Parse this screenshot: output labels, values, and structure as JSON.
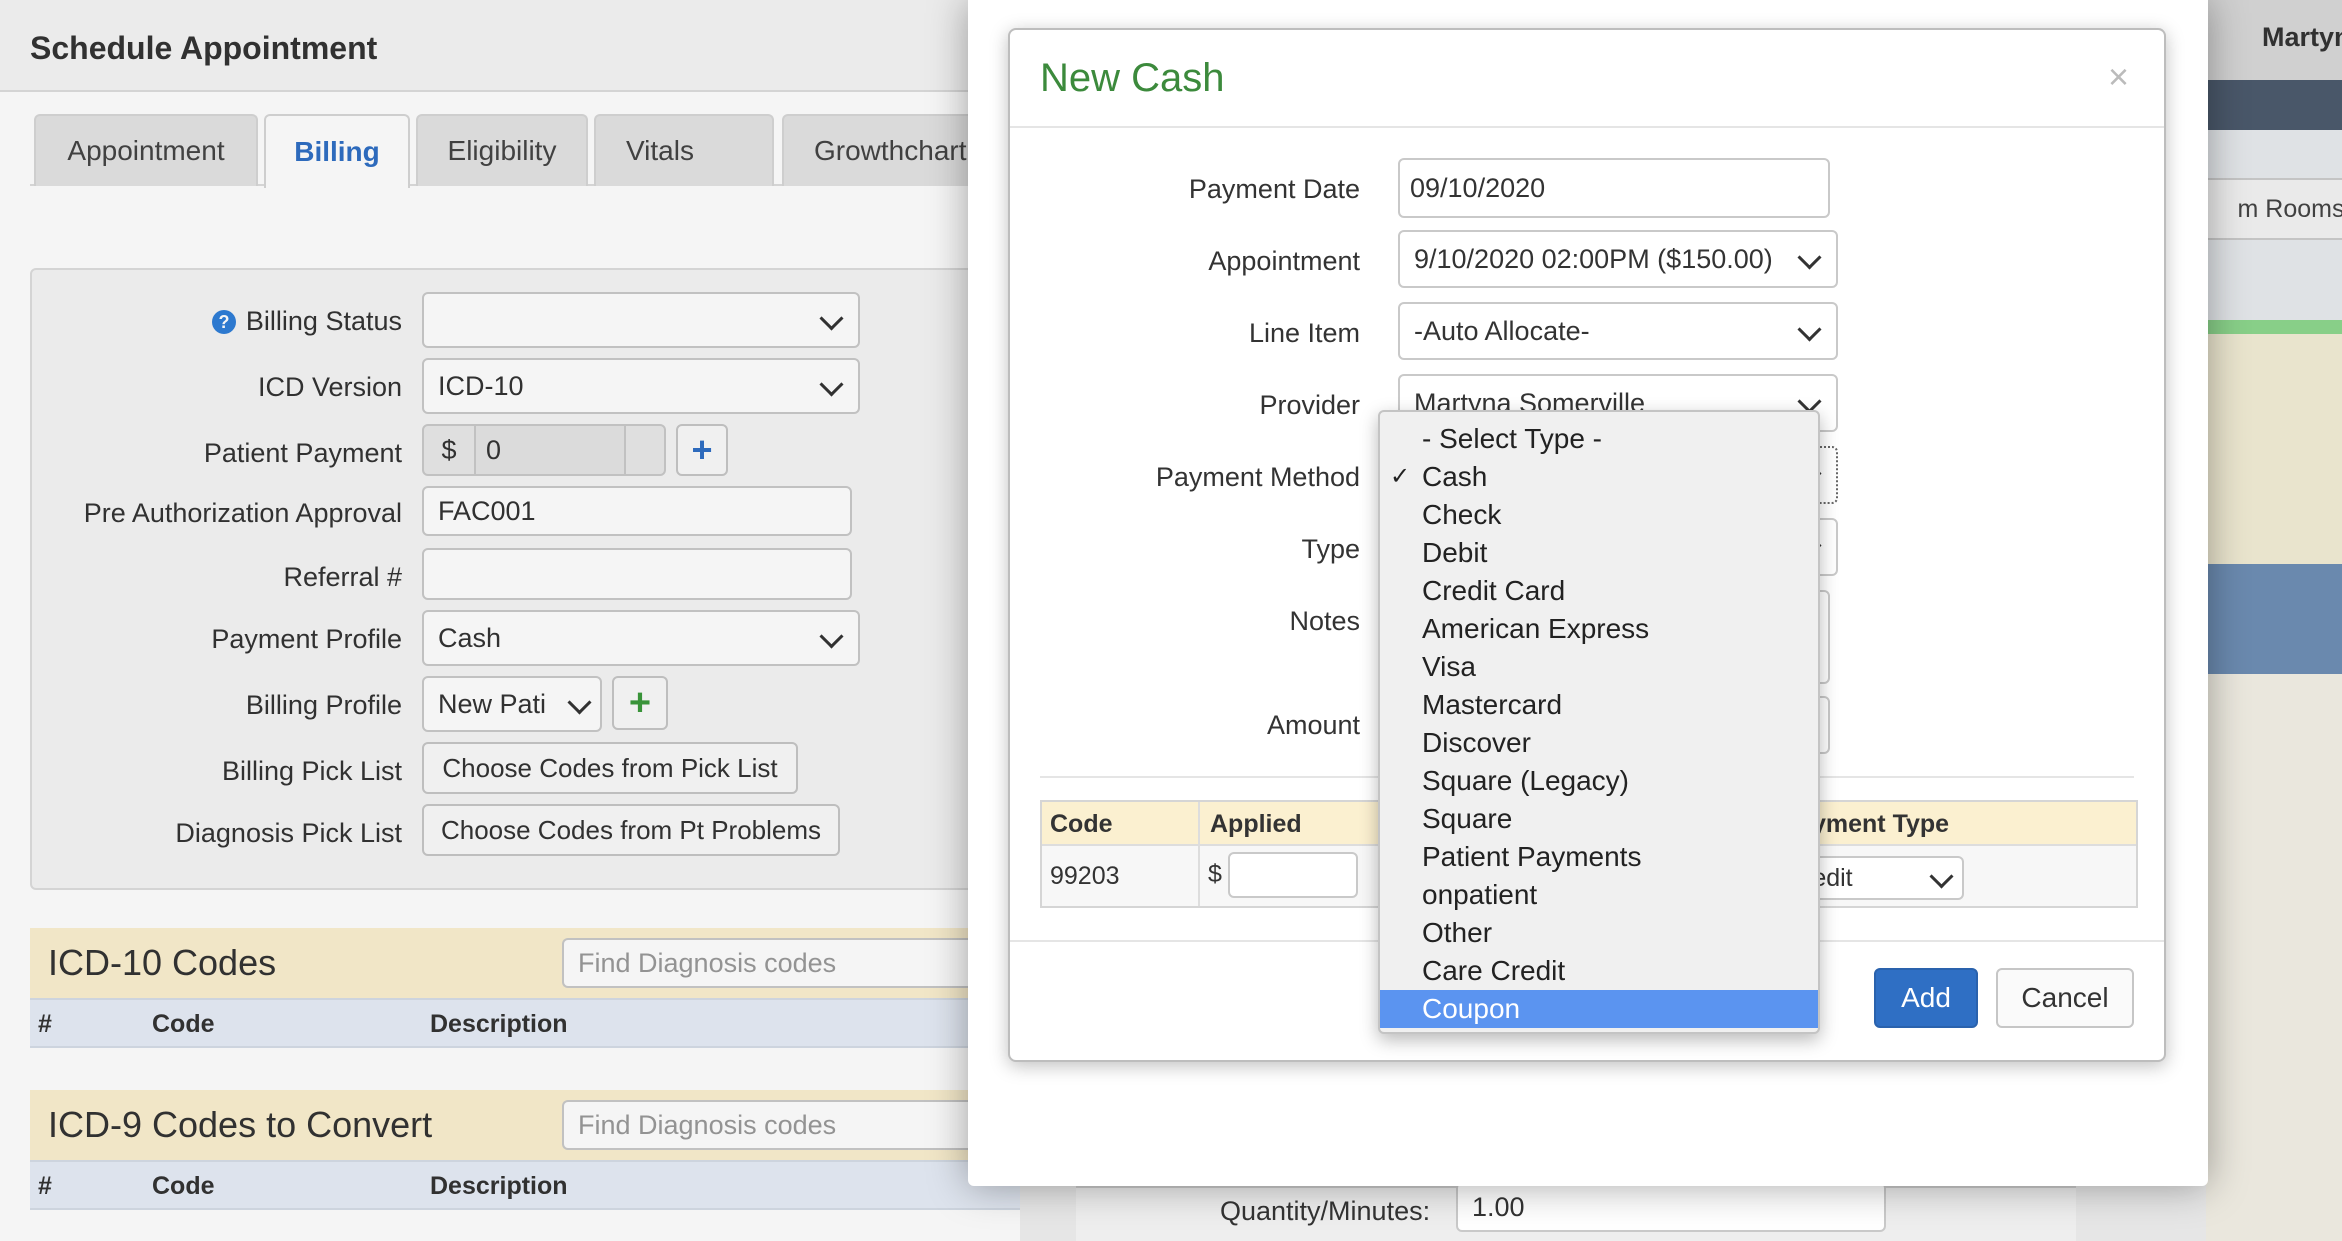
{
  "background": {
    "title": "Schedule Appointment",
    "tabs": [
      {
        "label": "Appointment"
      },
      {
        "label": "Billing"
      },
      {
        "label": "Eligibility"
      },
      {
        "label": "Vitals"
      },
      {
        "label": "Growthchart"
      }
    ],
    "active_tab": "Billing",
    "form": {
      "billing_status_label": "Billing Status",
      "icd_version_label": "ICD Version",
      "icd_version_value": "ICD-10",
      "patient_payment_label": "Patient Payment",
      "patient_payment_prefix": "$",
      "patient_payment_value": "0",
      "preauth_label": "Pre Authorization Approval",
      "preauth_value": "FAC001",
      "referral_label": "Referral #",
      "payment_profile_label": "Payment Profile",
      "payment_profile_value": "Cash",
      "billing_profile_label": "Billing Profile",
      "billing_profile_value": "New Pati",
      "billing_pick_label": "Billing Pick List",
      "billing_pick_button": "Choose Codes from Pick List",
      "diagnosis_pick_label": "Diagnosis Pick List",
      "diagnosis_pick_button": "Choose Codes from Pt Problems"
    },
    "icd10": {
      "title": "ICD-10 Codes",
      "search_placeholder": "Find Diagnosis codes",
      "col_num": "#",
      "col_code": "Code",
      "col_desc": "Description"
    },
    "icd9": {
      "title": "ICD-9 Codes to Convert",
      "search_placeholder": "Find Diagnosis codes",
      "col_num": "#",
      "col_code": "Code",
      "col_desc": "Description"
    },
    "right_user": "Martyn",
    "right_rooms": "m Rooms",
    "quantity_label": "Quantity/Minutes:",
    "quantity_value": "1.00"
  },
  "modal": {
    "title": "New Cash",
    "close_glyph": "×",
    "payment_date_label": "Payment Date",
    "payment_date_value": "09/10/2020",
    "appointment_label": "Appointment",
    "appointment_value": "9/10/2020 02:00PM ($150.00)",
    "line_item_label": "Line Item",
    "line_item_value": "-Auto Allocate-",
    "provider_label": "Provider",
    "provider_value": "Martyna Somerville",
    "payment_method_label": "Payment Method",
    "type_label": "Type",
    "notes_label": "Notes",
    "amount_label": "Amount",
    "table": {
      "col_code": "Code",
      "col_applied": "Applied",
      "col_payment_type": "yment Type",
      "row_code": "99203",
      "row_currency": "$",
      "row_payment_type": "redit"
    },
    "add_button": "Add",
    "cancel_button": "Cancel"
  },
  "dropdown": {
    "checkmark": "✓",
    "selected": "Cash",
    "highlighted": "Coupon",
    "options": [
      {
        "label": "- Select Type -"
      },
      {
        "label": "Cash"
      },
      {
        "label": "Check"
      },
      {
        "label": "Debit"
      },
      {
        "label": "Credit Card"
      },
      {
        "label": "American Express"
      },
      {
        "label": "Visa"
      },
      {
        "label": "Mastercard"
      },
      {
        "label": "Discover"
      },
      {
        "label": "Square (Legacy)"
      },
      {
        "label": "Square"
      },
      {
        "label": "Patient Payments"
      },
      {
        "label": "onpatient"
      },
      {
        "label": "Other"
      },
      {
        "label": "Care Credit"
      },
      {
        "label": "Coupon"
      }
    ]
  },
  "colors": {
    "modal_title": "#3c8a3c",
    "primary_button": "#2f6fc4",
    "highlight": "#5b94f0",
    "section_header": "#fbf0d0",
    "table_header": "#e6edf7",
    "plus_blue": "#2f6fc4",
    "plus_green": "#3c9a3c",
    "help_icon": "#2f7ed8"
  }
}
